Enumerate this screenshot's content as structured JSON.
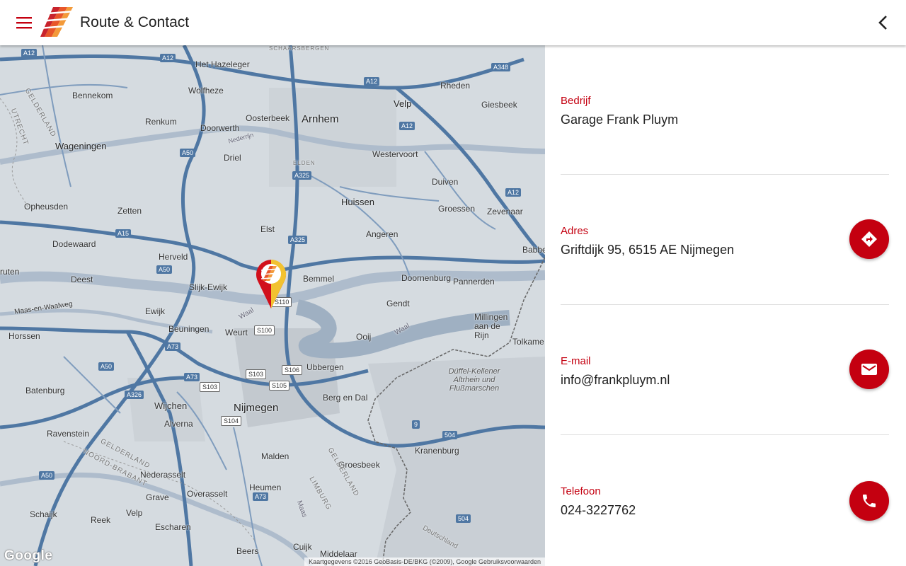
{
  "appbar": {
    "title": "Route & Contact",
    "menu_icon": "menu-icon",
    "back_icon": "chevron-left-icon"
  },
  "colors": {
    "accent": "#c40010",
    "map_bg": "#d5dbe0",
    "highway": "#4f77a3"
  },
  "map": {
    "labels": {
      "arnhem": "Arnhem",
      "nijmegen": "Nijmegen",
      "wageningen": "Wageningen",
      "velp": "Velp",
      "huissen": "Huissen",
      "elst": "Elst",
      "bemmel": "Bemmel",
      "gendt": "Gendt",
      "het_hazeleger": "Het Hazeleger",
      "bennekom": "Bennekom",
      "wolfheze": "Wolfheze",
      "oosterbeek": "Oosterbeek",
      "renkum": "Renkum",
      "doorwerth": "Doorwerth",
      "driel": "Driel",
      "westervoort": "Westervoort",
      "rheden": "Rheden",
      "giesbeek": "Giesbeek",
      "duiven": "Duiven",
      "groessen": "Groessen",
      "zevenaar": "Zevenaar",
      "opheusden": "Opheusden",
      "zetten": "Zetten",
      "dodewaard": "Dodewaard",
      "herveld": "Herveld",
      "angeren": "Angeren",
      "babbe": "Babbe",
      "doornenburg": "Doornenburg",
      "pannerden": "Pannerden",
      "slijk_ewijk": "Slijk-Ewijk",
      "deest": "Deest",
      "ewijk": "Ewijk",
      "beuningen": "Beuningen",
      "weurt": "Weurt",
      "horssen": "Horssen",
      "ooij": "Ooij",
      "millingen": "Millingen aan de Rijn",
      "tolkame": "Tolkame",
      "ubbergen": "Ubbergen",
      "berg_en_dal": "Berg en Dal",
      "batenburg": "Batenburg",
      "wijchen": "Wijchen",
      "alverna": "Alverna",
      "ravenstein": "Ravenstein",
      "nederasselt": "Nederasselt",
      "overasselt": "Overasselt",
      "malden": "Malden",
      "groesbeek": "Groesbeek",
      "kranenburg": "Kranenburg",
      "heumen": "Heumen",
      "grave": "Grave",
      "schaijk": "Schaijk",
      "reek": "Reek",
      "velp2": "Velp",
      "escharen": "Escharen",
      "beers": "Beers",
      "cuijk": "Cuijk",
      "middelaar": "Middelaar",
      "ruten": "ruten",
      "maas_en_waalweg": "Maas-en-Waalweg",
      "waal1": "Waal",
      "waal2": "Waal",
      "maas": "Maas",
      "nederrijn": "Nederrijn",
      "duffel": "Düffel-Kellener Altrhein und Flußmarschen",
      "utrecht": "UTRECHT",
      "gelderland1": "GELDERLAND",
      "gelderland2": "GELDERLAND",
      "gelderland3": "GELDERLAND",
      "noord_brabant": "NOORD-BRABANT",
      "limburg": "LIMBURG",
      "deutschland": "Deutschland",
      "schaarsbergen": "SCHAARSBERGEN",
      "elden": "ELDEN"
    },
    "shields": {
      "a12a": "A12",
      "a12b": "A12",
      "a12c": "A12",
      "a12d": "A12",
      "a348": "A348",
      "a50a": "A50",
      "a50b": "A50",
      "a50c": "A50",
      "a50d": "A50",
      "a325a": "A325",
      "a325b": "A325",
      "a15": "A15",
      "a73a": "A73",
      "a73b": "A73",
      "a73c": "A73",
      "a326": "A326",
      "s110": "S110",
      "s100": "S100",
      "s103": "S103",
      "s106": "S106",
      "s105": "S105",
      "s104": "S104",
      "b9": "9",
      "b504a": "504",
      "b504b": "504"
    },
    "google_logo": "Google",
    "attribution": "Kaartgegevens ©2016 GeoBasis-DE/BKG (©2009), Google   Gebruiksvoorwaarden"
  },
  "contact": {
    "company": {
      "label": "Bedrijf",
      "value": "Garage Frank Pluym"
    },
    "address": {
      "label": "Adres",
      "value": "Griftdijk 95, 6515 AE Nijmegen",
      "action_icon": "directions-icon"
    },
    "email": {
      "label": "E-mail",
      "value": "info@frankpluym.nl",
      "action_icon": "mail-icon"
    },
    "phone": {
      "label": "Telefoon",
      "value": "024-3227762",
      "action_icon": "phone-icon"
    }
  }
}
